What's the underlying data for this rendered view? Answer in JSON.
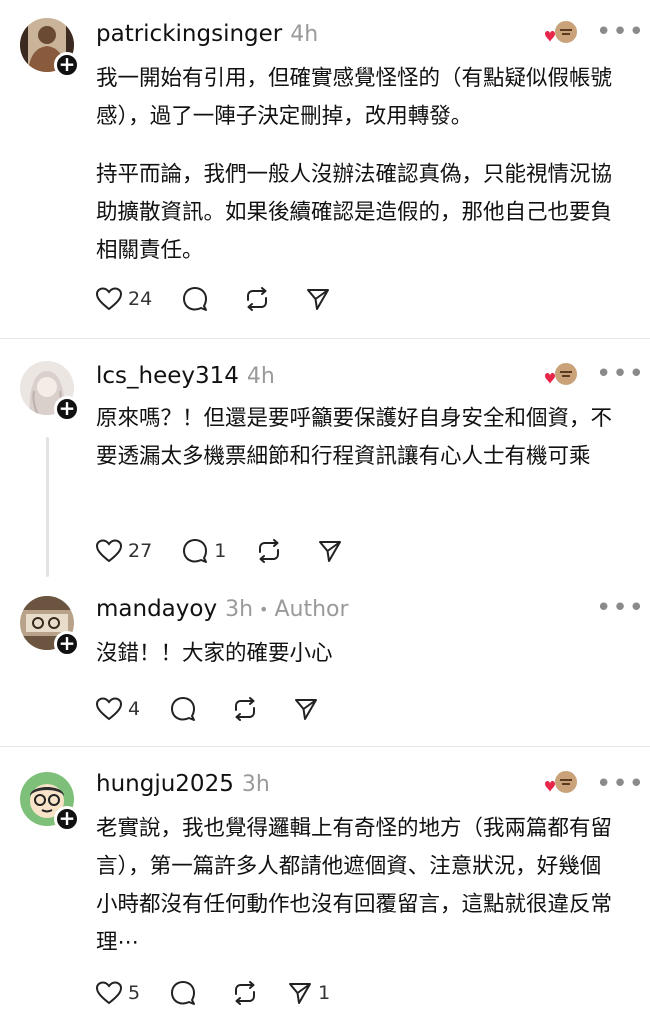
{
  "comments": [
    {
      "username": "patrickingsinger",
      "time": "4h",
      "paragraphs": [
        "我一開始有引用，但確實感覺怪怪的（有點疑似假帳號感），過了一陣子決定刪掉，改用轉發。",
        "持平而論，我們一般人沒辦法確認真偽，只能視情況協助擴散資訊。如果後續確認是造假的，那他自己也要負相關責任。"
      ],
      "likes": "24",
      "replies": "",
      "shares": "",
      "liked_by_author": true
    },
    {
      "username": "lcs_heey314",
      "time": "4h",
      "paragraphs": [
        "原來嗎？！但還是要呼籲要保護好自身安全和個資，不要透漏太多機票細節和行程資訊讓有心人士有機可乘"
      ],
      "likes": "27",
      "replies": "1",
      "shares": "",
      "liked_by_author": true
    },
    {
      "username": "mandayoy",
      "time": "3h",
      "author_badge": "Author",
      "paragraphs": [
        "沒錯！！大家的確要小心"
      ],
      "likes": "4",
      "replies": "",
      "shares": "",
      "liked_by_author": false
    },
    {
      "username": "hungju2025",
      "time": "3h",
      "paragraphs": [
        "老實說，我也覺得邏輯上有奇怪的地方（我兩篇都有留言），第一篇許多人都請他遮個資、注意狀況，好幾個小時都沒有任何動作也沒有回覆留言，這點就很違反常理⋯"
      ],
      "likes": "5",
      "replies": "",
      "shares": "1",
      "liked_by_author": true
    }
  ],
  "icons": {
    "like": "heart-icon",
    "reply": "comment-icon",
    "repost": "repost-icon",
    "share": "send-icon",
    "more": "more-icon",
    "follow": "plus-icon"
  },
  "colors": {
    "heart_red": "#e8264a",
    "muted": "#9a9a9a"
  }
}
